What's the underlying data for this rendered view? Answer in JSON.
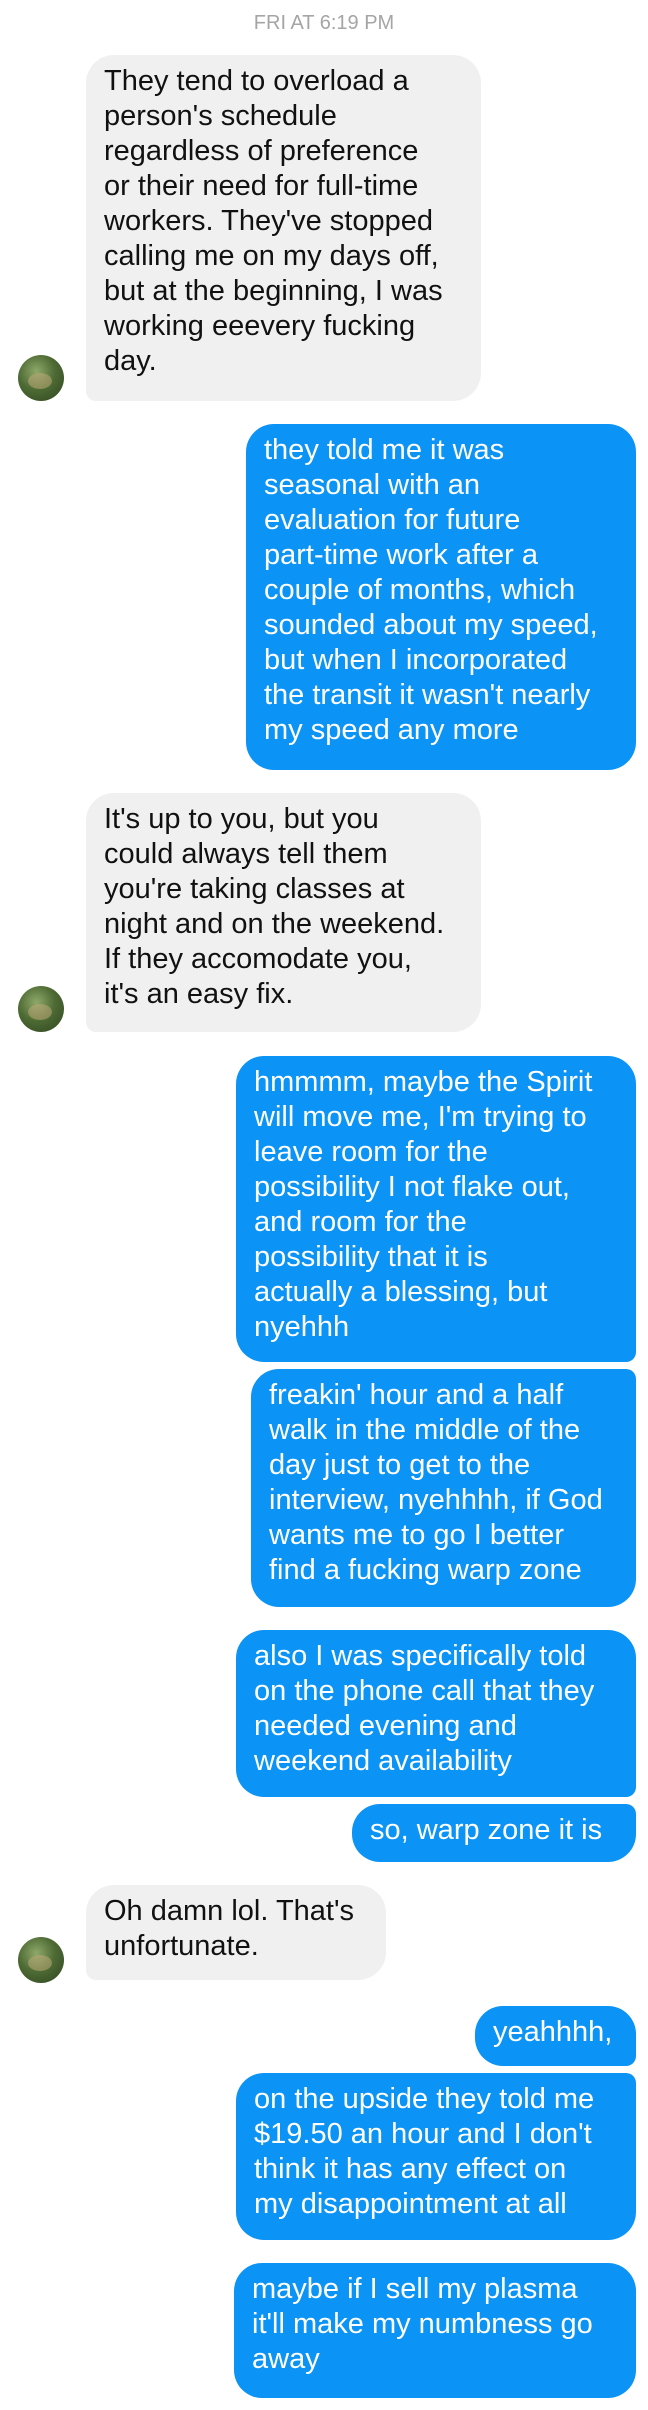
{
  "conversation": {
    "timestamp": "FRI AT 6:19 PM",
    "messages": [
      {
        "sender": "them",
        "text": "They tend to overload a\nperson's schedule\nregardless of preference\nor their need for full-time\nworkers. They've stopped\ncalling me on my days off,\nbut at the beginning, I was\nworking eeevery fucking\nday."
      },
      {
        "sender": "me",
        "text": "they told me it was\nseasonal with an\nevaluation for future\npart-time work after a\ncouple of months, which\nsounded about my speed,\nbut when I incorporated\nthe transit it wasn't nearly\nmy speed any more"
      },
      {
        "sender": "them",
        "text": "It's up to you, but you\ncould always tell them\nyou're taking classes at\nnight and on the weekend.\nIf they accomodate you,\nit's an easy fix."
      },
      {
        "sender": "me",
        "text": "hmmmm, maybe the Spirit\nwill move me, I'm trying to\nleave room for the\npossibility I not flake out,\nand room for the\npossibility that it is\nactually a blessing, but\nnyehhh"
      },
      {
        "sender": "me",
        "text": "freakin' hour and a half\nwalk in the middle of the\nday just to get to the\ninterview, nyehhhh, if God\nwants me to go I better\nfind a fucking warp zone"
      },
      {
        "sender": "me",
        "text": "also I was specifically told\non the phone call that they\nneeded evening and\nweekend availability"
      },
      {
        "sender": "me",
        "text": "so, warp zone it is"
      },
      {
        "sender": "them",
        "text": "Oh damn lol. That's\nunfortunate."
      },
      {
        "sender": "me",
        "text": "yeahhhh,"
      },
      {
        "sender": "me",
        "text": "on the upside they told me\n$19.50 an hour and I don't\nthink it has any effect on\nmy disappointment at all"
      },
      {
        "sender": "me",
        "text": "maybe if I sell my plasma\nit'll make my numbness go\naway"
      }
    ]
  },
  "colors": {
    "outgoing_bubble": "#0b93f6",
    "incoming_bubble": "#f0f0f0",
    "timestamp_text": "#a5a5a5"
  },
  "icons": {
    "avatar": "contact-avatar-photo"
  }
}
